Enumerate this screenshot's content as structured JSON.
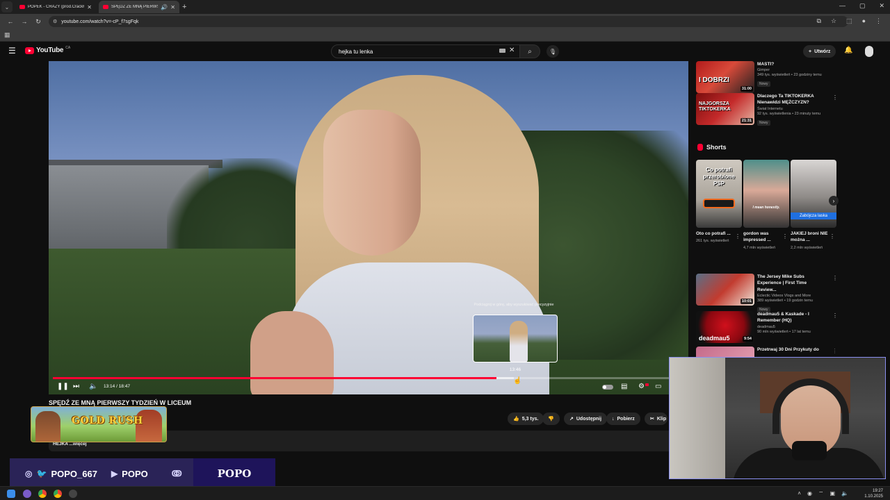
{
  "browser": {
    "tabs": [
      {
        "title": "POPEK - CRAZY (prod.CrackHo",
        "active": false
      },
      {
        "title": "SPĘDŹ ZE MNĄ PIERWSZY",
        "active": true
      }
    ],
    "url": "youtube.com/watch?v=-cP_f7sgFqk"
  },
  "youtube": {
    "logo_text": "YouTube",
    "country_code": "CA",
    "search_query": "hejka tu lenka",
    "create_label": "Utwórz"
  },
  "player": {
    "scrub_hint": "Podciągnij w górę, aby wyszukiwać precyzyjnie",
    "preview_time": "13:46",
    "time_display": "13:14 / 18:47",
    "played_fraction": 0.703,
    "buffered_fraction": 0.73
  },
  "video": {
    "title": "SPĘDŹ ZE MNĄ PIERWSZY TYDZIEŃ W LICEUM",
    "likes": "5,3 tys.",
    "share_label": "Udostępnij",
    "download_label": "Pobierz",
    "clip_label": "Klip",
    "description_snippet": "HEJKA ...więcej"
  },
  "sidebar": {
    "videos_top": [
      {
        "title": "MASTI?",
        "channel": "Gimper",
        "meta": "349 tys. wyświetleń • 23 godziny temu",
        "badge": "Nowy",
        "duration": "31:00",
        "thumb_text": "I DOBRZI"
      },
      {
        "title": "Dlaczego Ta TIKTOKERKA Nienawidzi MĘŻCZYZN?",
        "channel": "Świat Internetu",
        "meta": "92 tys. wyświetlenia • 23 minuty temu",
        "badge": "Nowy",
        "duration": "21:31",
        "thumb_text": "NAJGORSZA TIKTOKERKA"
      }
    ],
    "shorts_heading": "Shorts",
    "shorts": [
      {
        "title": "Oto co potrafi ...",
        "views": "261 tys. wyświetleń",
        "thumb_text": "Co potrafi przerobione PSP"
      },
      {
        "title": "gordon was impressed ...",
        "views": "4,7 mln wyświetleń",
        "thumb_text": "I mean honestly."
      },
      {
        "title": "JAKIEJ broni NIE można ...",
        "views": "2,2 mln wyświetleń",
        "thumb_text": "Zabójcza laska"
      }
    ],
    "videos_bottom": [
      {
        "title": "The Jersey Mike Subs Experience | First Time Review...",
        "channel": "Eclectic Videos Vlogs and More",
        "meta": "389 wyświetleń • 19 godzin temu",
        "badge": "Nowy",
        "duration": "10:01",
        "thumb_text": ""
      },
      {
        "title": "deadmau5 & Kaskade - I Remember (HQ)",
        "channel": "deadmau5",
        "meta": "90 mln wyświetleń • 17 lat temu",
        "badge": "",
        "duration": "9:54",
        "thumb_text": "deadmau5"
      },
      {
        "title": "Przetrwaj 30 Dni Przykuty do",
        "channel": "",
        "meta": "",
        "badge": "",
        "duration": "",
        "thumb_text": ""
      }
    ]
  },
  "overlay": {
    "social_handle": "POPO_667",
    "youtube_handle": "POPO",
    "name_plate": "POPO",
    "game_banner": "GOLD RUSH"
  },
  "taskbar": {
    "time": "19:27",
    "date": "1.10.2025"
  },
  "colors": {
    "accent_red": "#ff0033",
    "overlay_purple": "#2a2357",
    "name_plate": "#1e145a"
  }
}
